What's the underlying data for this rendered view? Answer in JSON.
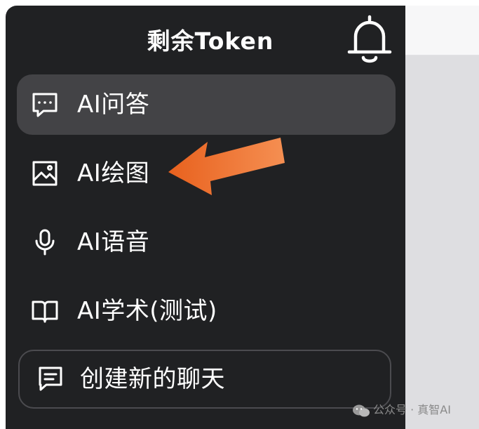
{
  "sidebar": {
    "title": "剩余Token",
    "items": [
      {
        "label": "AI问答",
        "icon": "chat-icon",
        "active": true
      },
      {
        "label": "AI绘图",
        "icon": "image-icon",
        "active": false
      },
      {
        "label": "AI语音",
        "icon": "microphone-icon",
        "active": false
      },
      {
        "label": "AI学术(测试)",
        "icon": "book-icon",
        "active": false
      }
    ],
    "new_chat": {
      "label": "创建新的聊天",
      "icon": "message-icon"
    }
  },
  "annotation": {
    "arrow_color": "#f07a2e",
    "points_to": "AI绘图"
  },
  "watermark": {
    "text": "公众号 · 真智AI",
    "icon": "wechat-icon"
  },
  "colors": {
    "sidebar_bg": "#202123",
    "active_item_bg": "#434346",
    "text": "#ffffff",
    "right_panel_bg": "#dedee1"
  }
}
